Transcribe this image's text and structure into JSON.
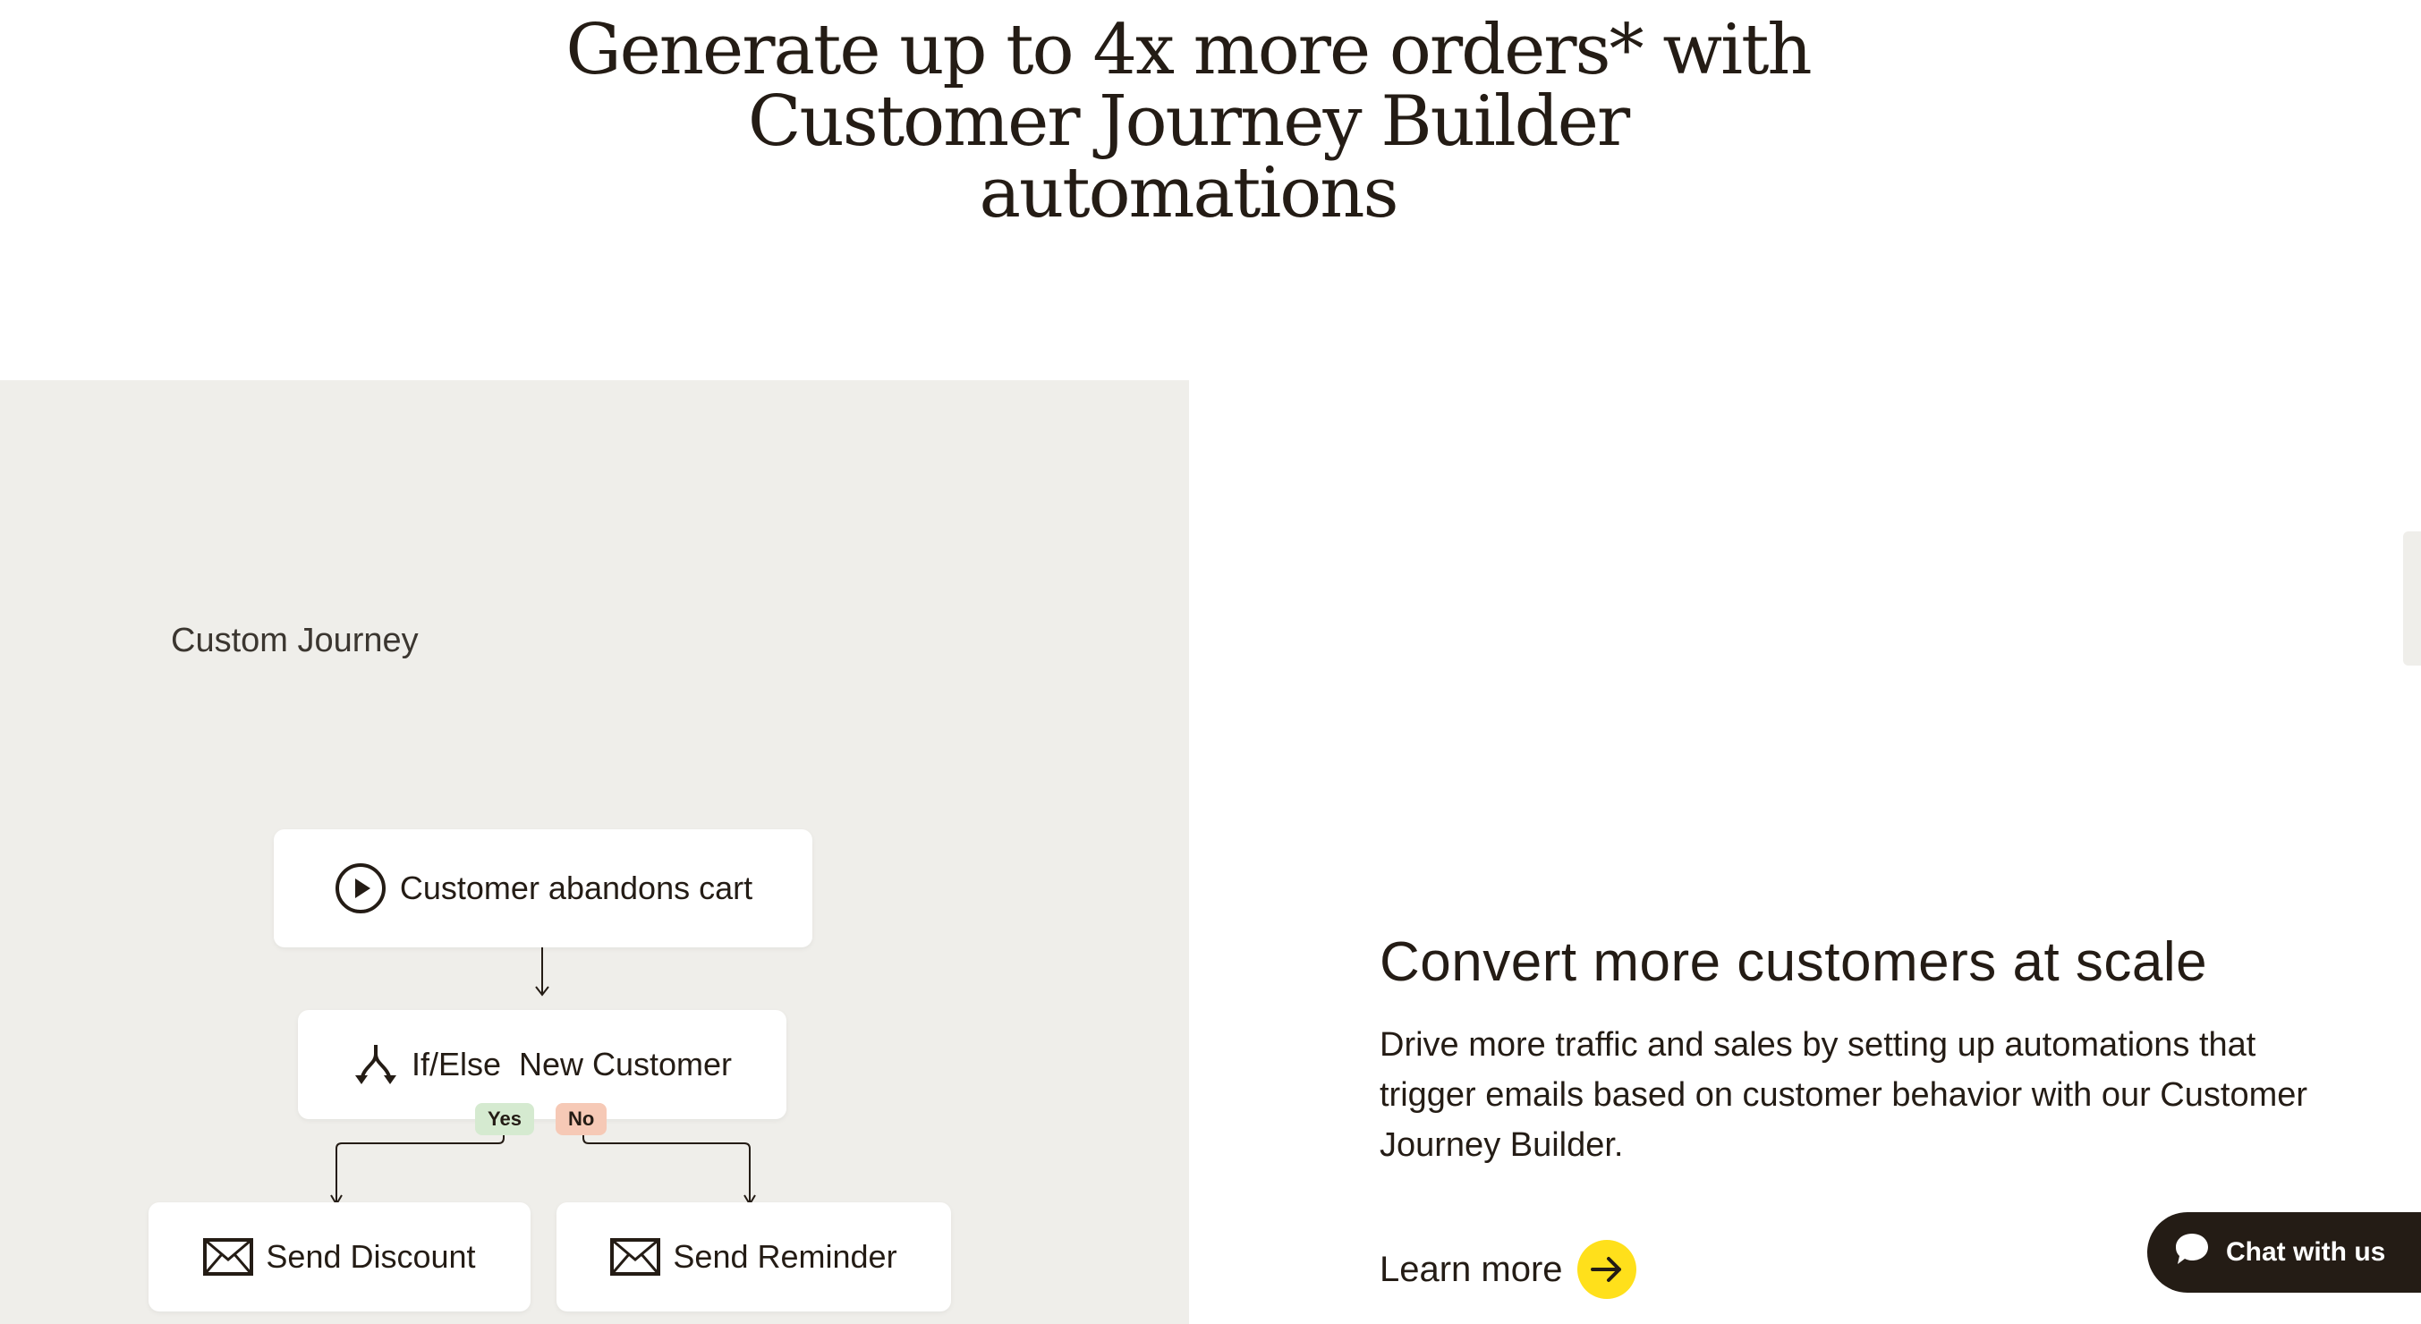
{
  "hero": {
    "title_line1": "Generate up to 4x more orders* with",
    "title_line2": "Customer Journey Builder",
    "title_line3": "automations"
  },
  "journey": {
    "label": "Custom Journey",
    "trigger": "Customer abandons cart",
    "condition": "If/Else  New Customer",
    "yes_tag": "Yes",
    "no_tag": "No",
    "action_yes": "Send Discount",
    "action_no": "Send Reminder"
  },
  "feature": {
    "title": "Convert more customers at scale",
    "body": "Drive more traffic and sales by setting up automations that trigger emails based on customer behavior with our Customer Journey Builder.",
    "link_label": "Learn more"
  },
  "chat": {
    "label": "Chat with us"
  },
  "colors": {
    "panel_bg": "#efeeea",
    "text": "#241c15",
    "accent_yellow": "#ffe01b",
    "yes_tag": "#d5ead0",
    "no_tag": "#f6c9b6",
    "chat_bg": "#241c15"
  },
  "icons": {
    "trigger": "play-circle-icon",
    "condition": "branch-split-icon",
    "action": "envelope-icon",
    "link": "arrow-right-icon",
    "chat": "speech-bubble-icon"
  }
}
